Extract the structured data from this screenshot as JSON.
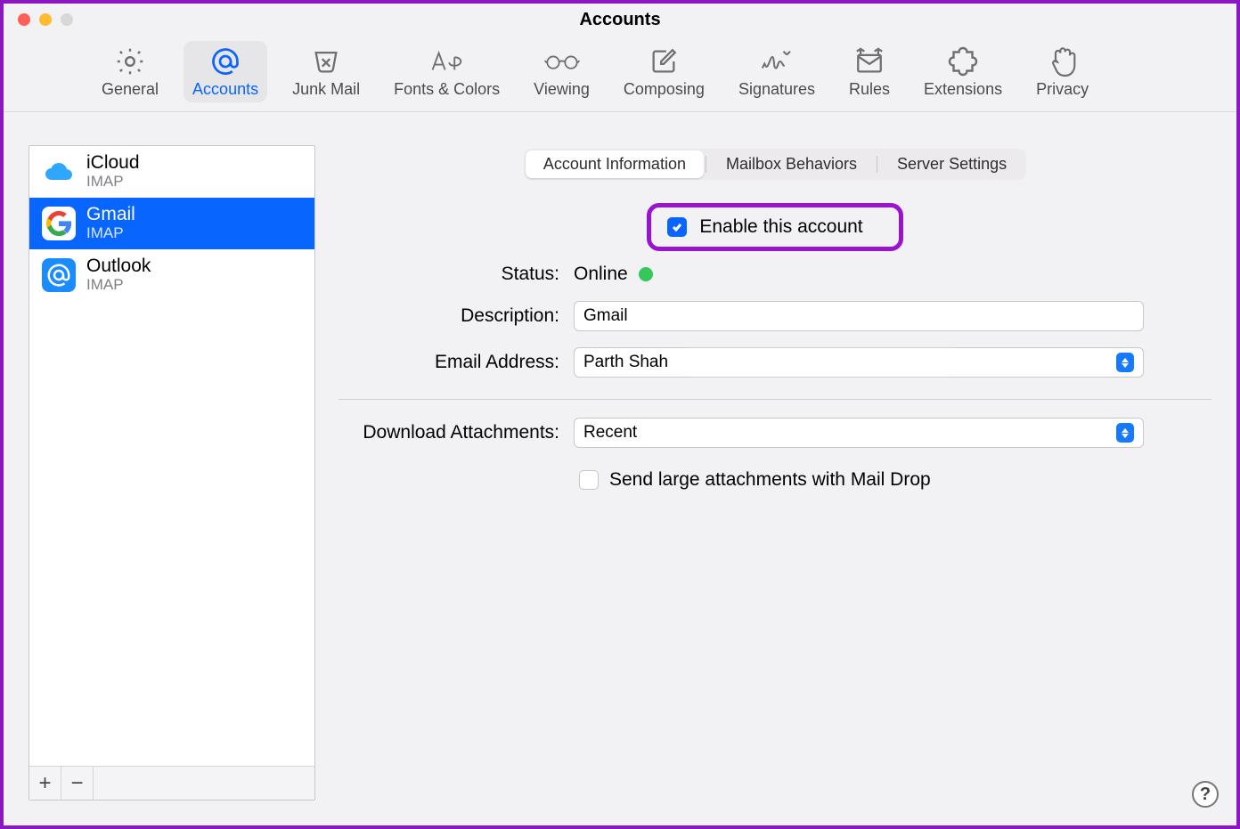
{
  "window": {
    "title": "Accounts"
  },
  "toolbar": [
    {
      "id": "general",
      "label": "General"
    },
    {
      "id": "accounts",
      "label": "Accounts"
    },
    {
      "id": "junk",
      "label": "Junk Mail"
    },
    {
      "id": "fonts",
      "label": "Fonts & Colors"
    },
    {
      "id": "viewing",
      "label": "Viewing"
    },
    {
      "id": "composing",
      "label": "Composing"
    },
    {
      "id": "signatures",
      "label": "Signatures"
    },
    {
      "id": "rules",
      "label": "Rules"
    },
    {
      "id": "extensions",
      "label": "Extensions"
    },
    {
      "id": "privacy",
      "label": "Privacy"
    }
  ],
  "toolbar_active": "accounts",
  "accounts": [
    {
      "name": "iCloud",
      "proto": "IMAP",
      "icon": "icloud"
    },
    {
      "name": "Gmail",
      "proto": "IMAP",
      "icon": "gmail",
      "selected": true
    },
    {
      "name": "Outlook",
      "proto": "IMAP",
      "icon": "outlook"
    }
  ],
  "side_buttons": {
    "add": "+",
    "remove": "−"
  },
  "tabs": [
    "Account Information",
    "Mailbox Behaviors",
    "Server Settings"
  ],
  "tabs_active": 0,
  "enable": {
    "checked": true,
    "label": "Enable this account"
  },
  "status": {
    "label": "Status:",
    "value": "Online"
  },
  "description": {
    "label": "Description:",
    "value": "Gmail"
  },
  "email": {
    "label": "Email Address:",
    "value": "Parth Shah"
  },
  "download": {
    "label": "Download Attachments:",
    "value": "Recent"
  },
  "maildrop": {
    "checked": false,
    "label": "Send large attachments with Mail Drop"
  },
  "help": "?"
}
